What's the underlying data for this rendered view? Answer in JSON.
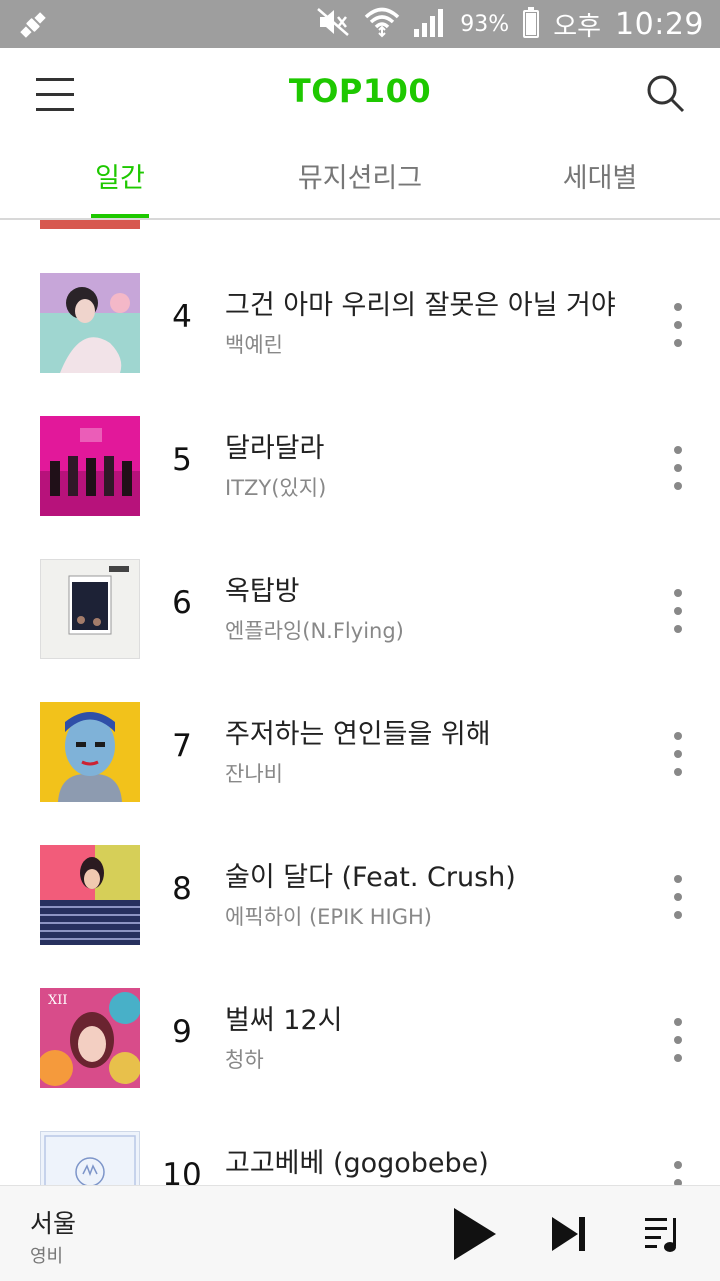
{
  "status_bar": {
    "battery": "93%",
    "ampm": "오후",
    "time": "10:29"
  },
  "header": {
    "title": "TOP100"
  },
  "tabs": [
    {
      "label": "일간",
      "active": true
    },
    {
      "label": "뮤지션리그",
      "active": false
    },
    {
      "label": "세대별",
      "active": false
    }
  ],
  "songs": [
    {
      "rank": "4",
      "title": "그건 아마 우리의 잘못은 아닐 거야",
      "artist": "백예린"
    },
    {
      "rank": "5",
      "title": "달라달라",
      "artist": "ITZY(있지)"
    },
    {
      "rank": "6",
      "title": "옥탑방",
      "artist": "엔플라잉(N.Flying)"
    },
    {
      "rank": "7",
      "title": "주저하는 연인들을 위해",
      "artist": "잔나비"
    },
    {
      "rank": "8",
      "title": "술이 달다 (Feat. Crush)",
      "artist": "에픽하이 (EPIK HIGH)"
    },
    {
      "rank": "9",
      "title": "벌써 12시",
      "artist": "청하"
    },
    {
      "rank": "10",
      "title": "고고베베 (gogobebe)",
      "artist": ""
    }
  ],
  "now_playing": {
    "title": "서울",
    "artist": "영비"
  },
  "colors": {
    "accent": "#1ec800",
    "status_bar": "#9e9e9e"
  }
}
